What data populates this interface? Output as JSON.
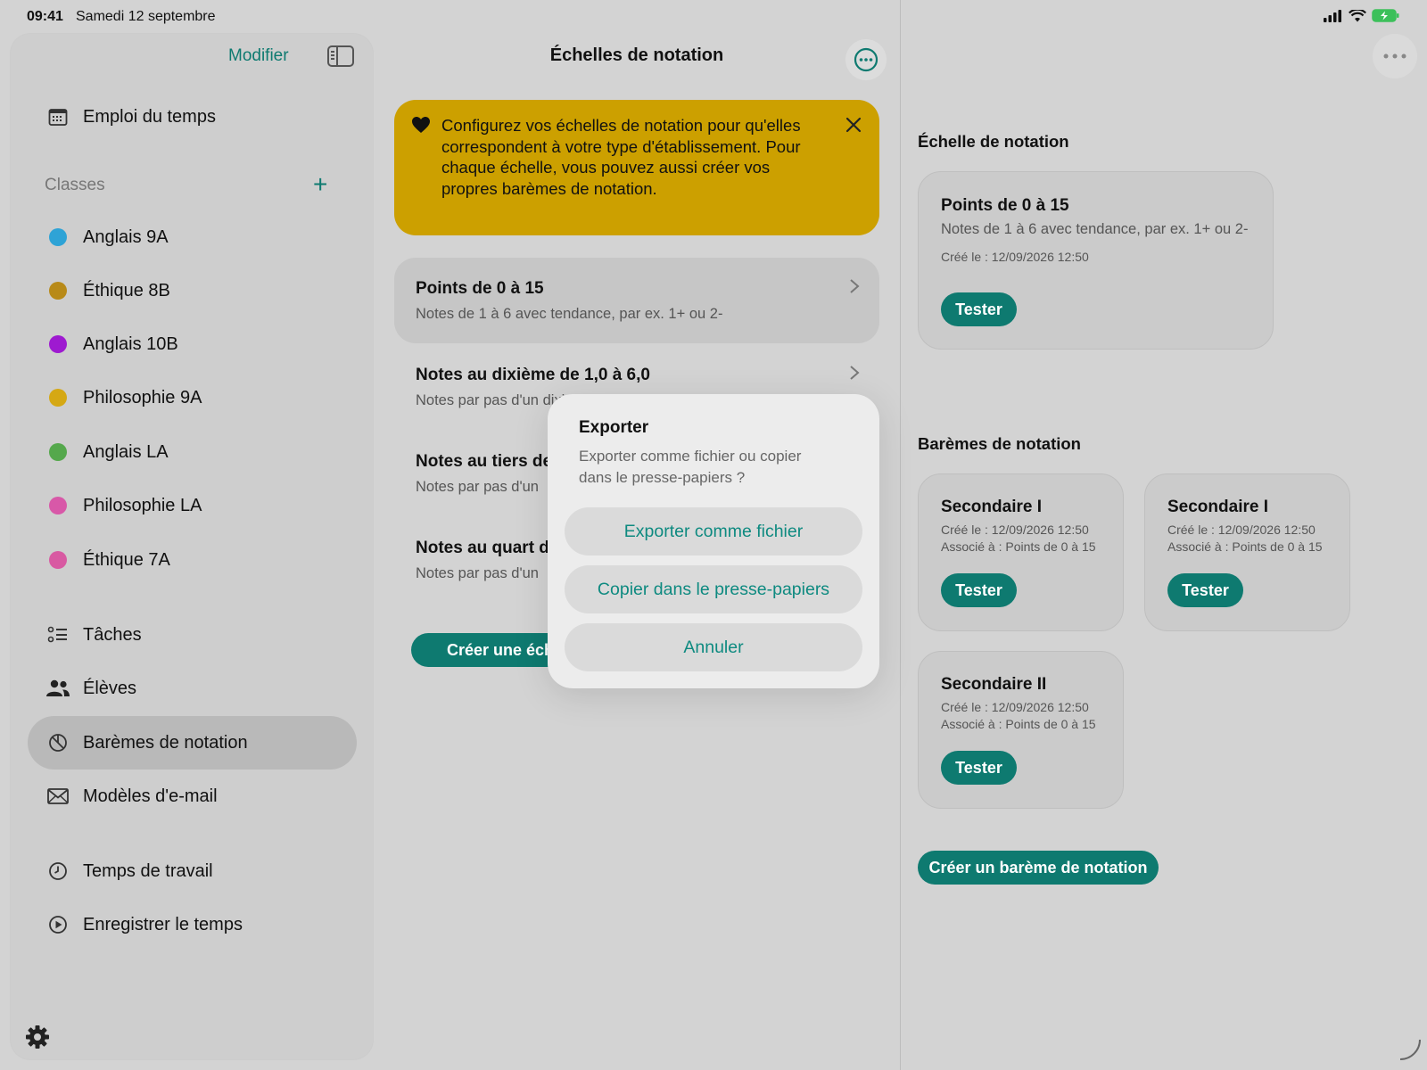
{
  "status": {
    "time": "09:41",
    "date": "Samedi 12 septembre"
  },
  "sidebar": {
    "modifier_label": "Modifier",
    "timetable": "Emploi du temps",
    "classes_header": "Classes",
    "classes": [
      {
        "label": "Anglais 9A",
        "color": "#2ea3d6"
      },
      {
        "label": "Éthique 8B",
        "color": "#b88a18"
      },
      {
        "label": "Anglais 10B",
        "color": "#9e1ad0"
      },
      {
        "label": "Philosophie 9A",
        "color": "#d5a814"
      },
      {
        "label": "Anglais LA",
        "color": "#55a84c"
      },
      {
        "label": "Philosophie LA",
        "color": "#d858a8"
      },
      {
        "label": "Éthique 7A",
        "color": "#d85aa2"
      }
    ],
    "nav": [
      {
        "label": "Tâches",
        "icon": "tasks-icon"
      },
      {
        "label": "Élèves",
        "icon": "students-icon"
      },
      {
        "label": "Barèmes de notation",
        "icon": "grading-scale-icon",
        "active": true
      },
      {
        "label": "Modèles d'e-mail",
        "icon": "mail-icon"
      },
      {
        "label": "Temps de travail",
        "icon": "clock-icon"
      },
      {
        "label": "Enregistrer le temps",
        "icon": "play-circle-icon"
      }
    ]
  },
  "middle": {
    "title": "Échelles de notation",
    "banner": "Configurez vos échelles de notation pour qu'elles correspondent à votre type d'établissement. Pour chaque échelle, vous pouvez aussi créer vos propres barèmes de notation.",
    "items": [
      {
        "title": "Points de 0 à 15",
        "subtitle": "Notes de 1 à 6 avec tendance, par ex. 1+ ou 2-"
      },
      {
        "title": "Notes au dixième de 1,0 à 6,0",
        "subtitle": "Notes par pas d'un dixi"
      },
      {
        "title": "Notes au tiers de",
        "subtitle": "Notes par pas d'un"
      },
      {
        "title": "Notes au quart d",
        "subtitle": "Notes par pas d'un"
      }
    ],
    "create_button": "Créer une échelle"
  },
  "dialog": {
    "title": "Exporter",
    "message": "Exporter comme fichier ou copier dans le presse-papiers ?",
    "export_file": "Exporter comme fichier",
    "copy_clipboard": "Copier dans le presse-papiers",
    "cancel": "Annuler"
  },
  "right": {
    "scale_header": "Échelle de notation",
    "scale_card": {
      "title": "Points de 0 à 15",
      "subtitle": "Notes de 1 à 6 avec tendance, par ex. 1+ ou 2-",
      "created": "Créé le : 12/09/2026 12:50",
      "test": "Tester"
    },
    "schemes_header": "Barèmes de notation",
    "schemes": [
      {
        "title": "Secondaire I",
        "created": "Créé le : 12/09/2026 12:50",
        "assoc": "Associé à : Points de 0 à 15",
        "test": "Tester"
      },
      {
        "title": "Secondaire I",
        "created": "Créé le : 12/09/2026 12:50",
        "assoc": "Associé à : Points de 0 à 15",
        "test": "Tester"
      },
      {
        "title": "Secondaire II",
        "created": "Créé le : 12/09/2026 12:50",
        "assoc": "Associé à : Points de 0 à 15",
        "test": "Tester"
      }
    ],
    "create_scheme": "Créer un barème de notation"
  },
  "colors": {
    "accent": "#0e7a70",
    "banner": "#cca000"
  }
}
